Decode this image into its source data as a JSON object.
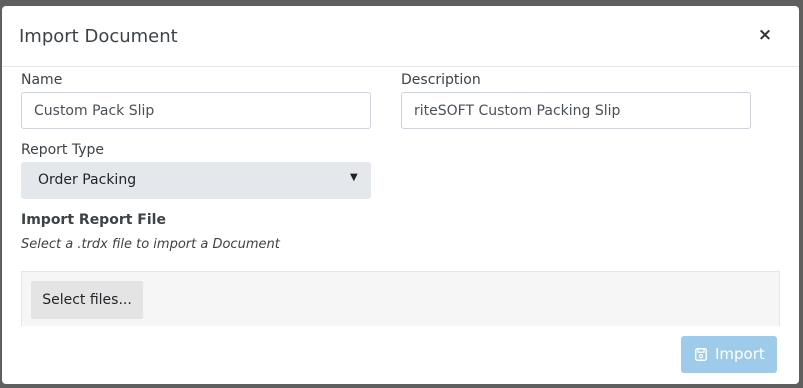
{
  "dialog": {
    "title": "Import Document",
    "close_symbol": "×"
  },
  "form": {
    "name": {
      "label": "Name",
      "value": "Custom Pack Slip"
    },
    "description": {
      "label": "Description",
      "value": "riteSOFT Custom Packing Slip"
    },
    "report_type": {
      "label": "Report Type",
      "selected": "Order Packing",
      "caret_icon": "caret-down-icon"
    },
    "import_file": {
      "title": "Import Report File",
      "hint": "Select a .trdx file to import a Document",
      "select_button_label": "Select files..."
    }
  },
  "footer": {
    "import_label": "Import",
    "import_icon": "save-icon",
    "import_color": "#9dcbe9"
  }
}
